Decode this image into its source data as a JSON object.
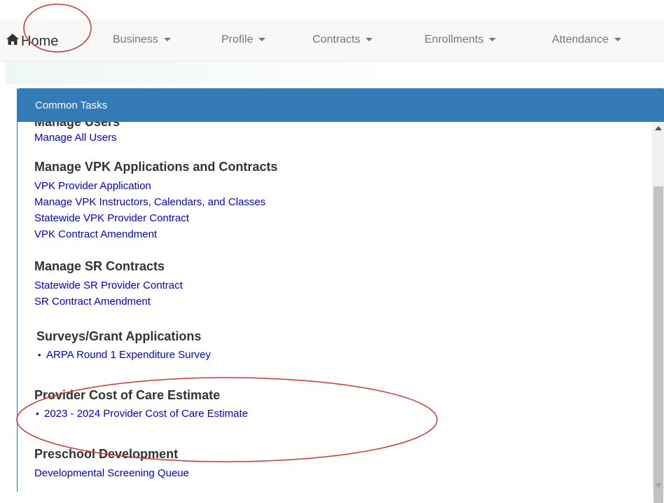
{
  "nav": {
    "home_label": "Home",
    "items": [
      {
        "label": "Business"
      },
      {
        "label": "Profile"
      },
      {
        "label": "Contracts"
      },
      {
        "label": "Enrollments"
      },
      {
        "label": "Attendance"
      }
    ]
  },
  "panel": {
    "title": "Common Tasks",
    "sections": [
      {
        "heading": "Manage Users",
        "links": [
          "Manage All Users"
        ]
      },
      {
        "heading": "Manage VPK Applications and Contracts",
        "links": [
          "VPK Provider Application",
          "Manage VPK Instructors, Calendars, and Classes",
          "Statewide VPK Provider Contract",
          "VPK Contract Amendment"
        ]
      },
      {
        "heading": "Manage SR Contracts",
        "links": [
          "Statewide SR Provider Contract",
          "SR Contract Amendment"
        ]
      },
      {
        "heading": "Surveys/Grant Applications",
        "links": [
          "ARPA Round 1 Expenditure Survey"
        ]
      },
      {
        "heading": "Provider Cost of Care Estimate",
        "links": [
          "2023 - 2024 Provider Cost of Care Estimate"
        ]
      },
      {
        "heading": "Preschool Development",
        "links": [
          "Developmental Screening Queue"
        ]
      }
    ]
  },
  "colors": {
    "panel_header": "#337ab7",
    "link": "#0000ee",
    "annotation": "#e03030"
  },
  "icons": {
    "home": "home-icon"
  }
}
